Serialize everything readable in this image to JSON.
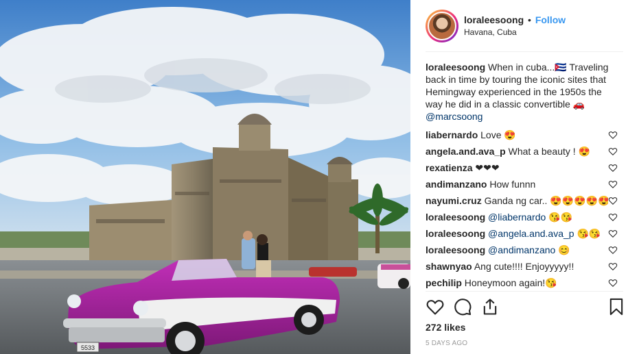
{
  "post": {
    "image_alt": "",
    "plate_text": "5533"
  },
  "header": {
    "username": "loraleesoong",
    "separator": "•",
    "follow_label": "Follow",
    "location": "Havana, Cuba"
  },
  "caption": {
    "username": "loraleesoong",
    "text": "When in cuba...🇨🇺 Traveling back in time by touring the iconic sites that Hemingway experienced in the 1950s the way he did in a classic convertible 🚗",
    "mention": "@marcsoong"
  },
  "comments": [
    {
      "username": "liabernardo",
      "text": "Love 😍",
      "mention": ""
    },
    {
      "username": "angela.and.ava_p",
      "text": "What a beauty ! 😍",
      "mention": ""
    },
    {
      "username": "rexatienza",
      "text": "❤❤❤",
      "mention": ""
    },
    {
      "username": "andimanzano",
      "text": "How funnn",
      "mention": ""
    },
    {
      "username": "nayumi.cruz",
      "text": "Ganda ng car.. 😍😍😍😍😍",
      "mention": ""
    },
    {
      "username": "loraleesoong",
      "text": "😘😘",
      "mention": "@liabernardo"
    },
    {
      "username": "loraleesoong",
      "text": "😘😘",
      "mention": "@angela.and.ava_p"
    },
    {
      "username": "loraleesoong",
      "text": "😊",
      "mention": "@andimanzano"
    },
    {
      "username": "shawnyao",
      "text": "Ang cute!!!! Enjoyyyyy!!",
      "mention": ""
    },
    {
      "username": "pechilip",
      "text": "Honeymoon again!😘",
      "mention": ""
    }
  ],
  "actions": {
    "like_icon": "heart-icon",
    "comment_icon": "comment-icon",
    "share_icon": "share-icon",
    "save_icon": "bookmark-icon"
  },
  "likes": "272 likes",
  "date": "5 DAYS AGO"
}
